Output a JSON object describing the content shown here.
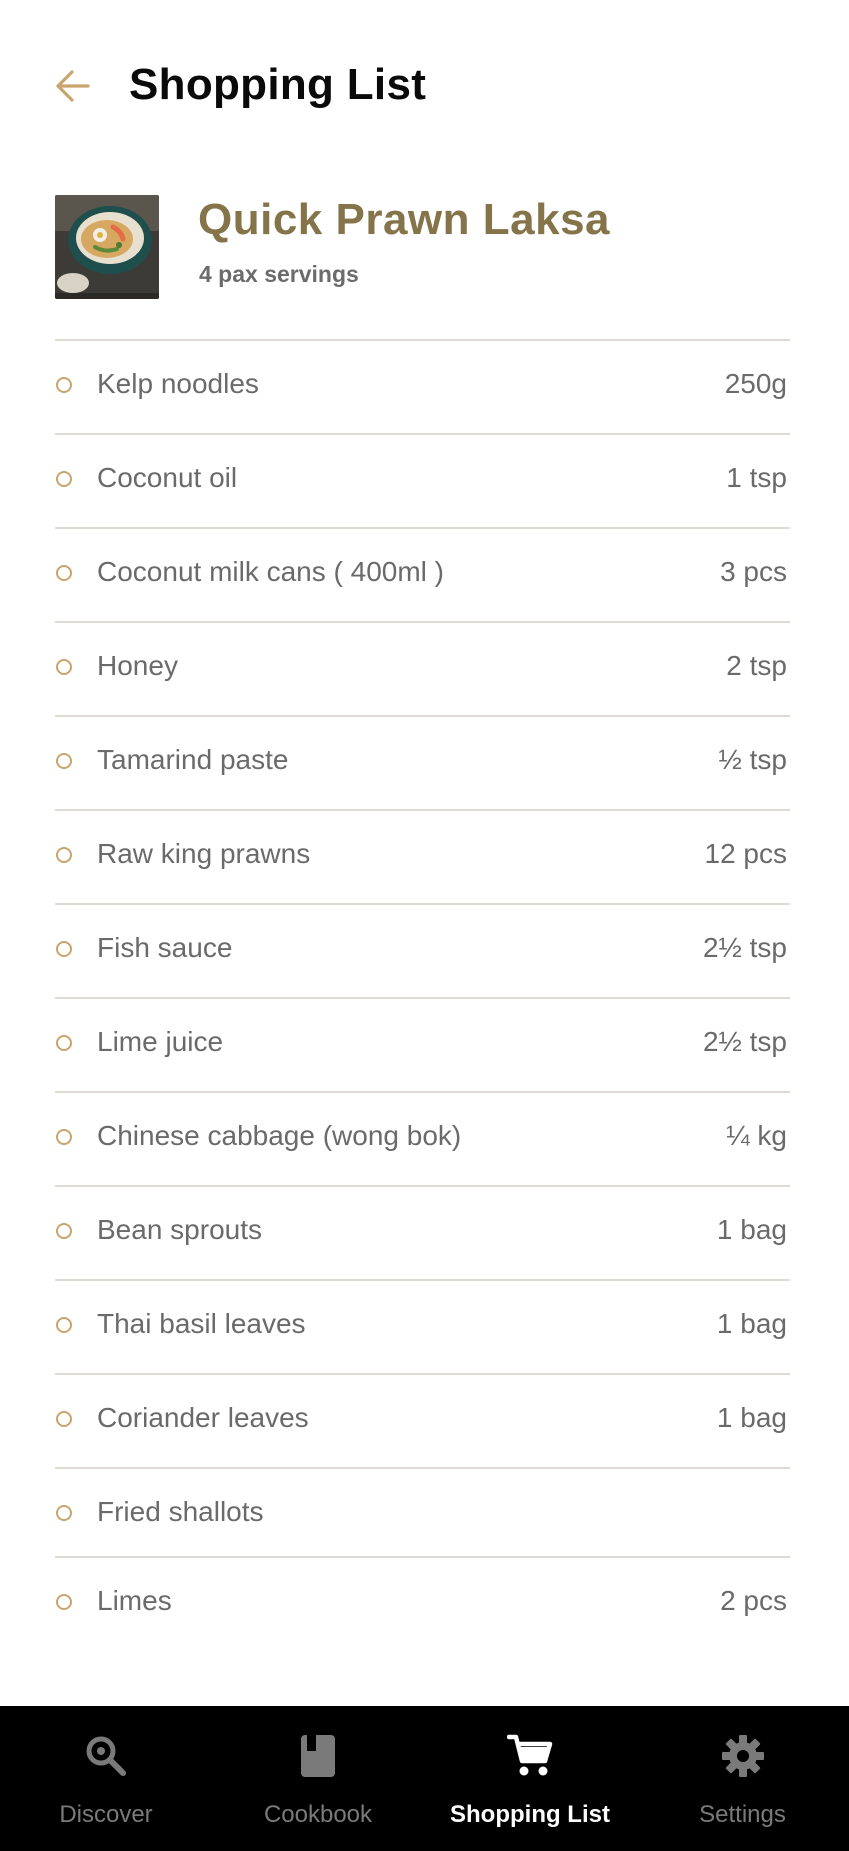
{
  "header": {
    "title": "Shopping List",
    "back_icon": "arrow-left-icon"
  },
  "recipe": {
    "name": "Quick Prawn Laksa",
    "servings": "4 pax servings",
    "image_icon": "laksa-bowl-thumbnail"
  },
  "ingredients": [
    {
      "name": "Kelp noodles",
      "qty": "250g"
    },
    {
      "name": "Coconut oil",
      "qty": "1 tsp"
    },
    {
      "name": "Coconut milk cans ( 400ml )",
      "qty": "3 pcs"
    },
    {
      "name": "Honey",
      "qty": "2 tsp"
    },
    {
      "name": "Tamarind paste",
      "qty": "½ tsp"
    },
    {
      "name": "Raw king prawns",
      "qty": "12 pcs"
    },
    {
      "name": "Fish sauce",
      "qty": "2½ tsp"
    },
    {
      "name": "Lime juice",
      "qty": "2½ tsp"
    },
    {
      "name": "Chinese cabbage (wong bok)",
      "qty": "¼ kg"
    },
    {
      "name": "Bean sprouts",
      "qty": "1 bag"
    },
    {
      "name": "Thai basil leaves",
      "qty": "1 bag"
    },
    {
      "name": "Coriander leaves",
      "qty": "1 bag"
    },
    {
      "name": "Fried shallots",
      "qty": ""
    },
    {
      "name": "Limes",
      "qty": "2 pcs"
    }
  ],
  "nav": {
    "items": [
      {
        "label": "Discover",
        "icon": "search-icon",
        "active": false
      },
      {
        "label": "Cookbook",
        "icon": "book-icon",
        "active": false
      },
      {
        "label": "Shopping List",
        "icon": "cart-icon",
        "active": true
      },
      {
        "label": "Settings",
        "icon": "gear-icon",
        "active": false
      }
    ]
  },
  "colors": {
    "accent": "#c9a46d",
    "recipe_title": "#857349",
    "divider": "#dcdad2",
    "nav_bg": "#000000",
    "nav_inactive": "#7a7a7a",
    "nav_active": "#ffffff"
  }
}
